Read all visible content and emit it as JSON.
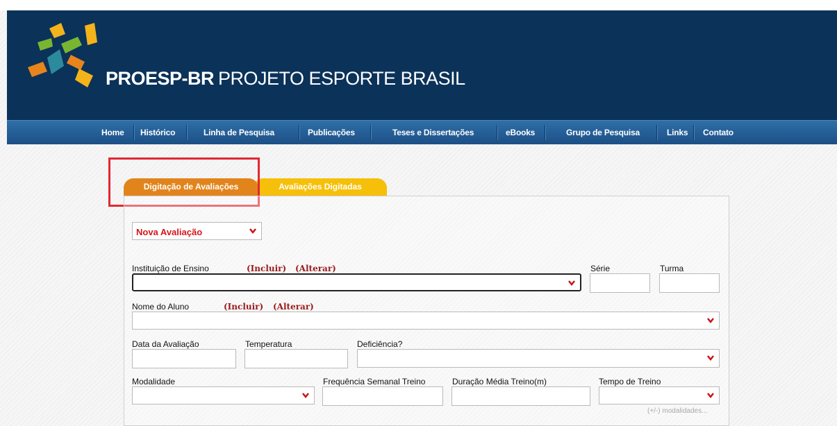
{
  "brand": {
    "bold": "PROESP-BR",
    "rest": "PROJETO ESPORTE BRASIL"
  },
  "nav": {
    "items": [
      "Home",
      "Histórico",
      "Linha de Pesquisa",
      "Publicações",
      "Teses e Dissertações",
      "eBooks",
      "Grupo de Pesquisa",
      "Links",
      "Contato"
    ]
  },
  "tabs": {
    "active": "Digitação de Avaliações",
    "inactive": "Avaliações Digitadas"
  },
  "form": {
    "mode_select": "Nova Avaliação",
    "instituicao": {
      "label": "Instituição de Ensino",
      "incluir": "(Incluir)",
      "alterar": "(Alterar)"
    },
    "serie": {
      "label": "Série"
    },
    "turma": {
      "label": "Turma"
    },
    "aluno": {
      "label": "Nome do Aluno",
      "incluir": "(Incluir)",
      "alterar": "(Alterar)"
    },
    "data": {
      "label": "Data da Avaliação"
    },
    "temperatura": {
      "label": "Temperatura"
    },
    "deficiencia": {
      "label": "Deficiência?"
    },
    "modalidade": {
      "label": "Modalidade"
    },
    "frequencia": {
      "label": "Frequência Semanal Treino"
    },
    "duracao": {
      "label": "Duração Média Treino(m)"
    },
    "tempo": {
      "label": "Tempo de Treino"
    },
    "hint": "(+/-) modalidades..."
  },
  "colors": {
    "header": "#0b3259",
    "tab_active": "#e2841c",
    "tab_inactive": "#f6c00a",
    "select_text": "#d4151b",
    "link": "#9b1b1b",
    "highlight": "#e32733"
  }
}
